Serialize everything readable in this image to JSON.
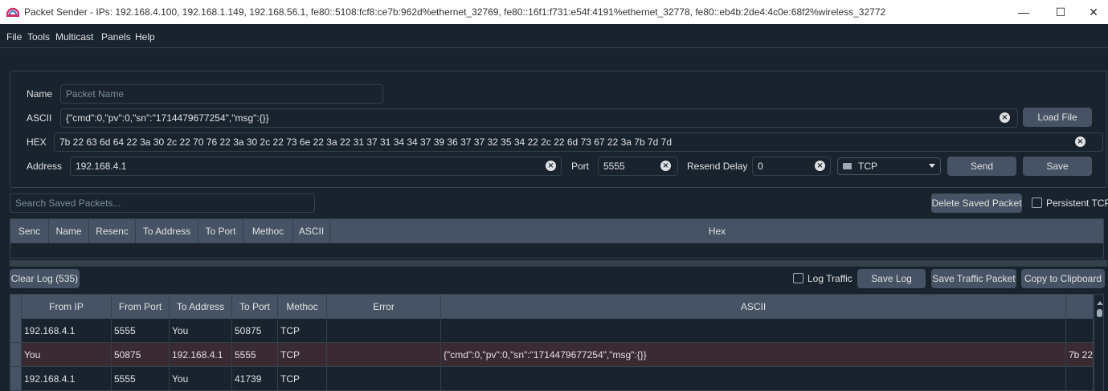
{
  "window": {
    "title": "Packet Sender - IPs: 192.168.4.100, 192.168.1.149, 192.168.56.1, fe80::5108:fcf8:ce7b:962d%ethernet_32769, fe80::16f1:f731:e54f:4191%ethernet_32778, fe80::eb4b:2de4:4c0e:68f2%wireless_32772",
    "minimize": "—",
    "maximize": "☐",
    "close": "✕"
  },
  "menu": [
    "File",
    "Tools",
    "Multicast",
    "Panels",
    "Help"
  ],
  "form": {
    "name_label": "Name",
    "name_placeholder": "Packet Name",
    "ascii_label": "ASCII",
    "ascii_value": "{\"cmd\":0,\"pv\":0,\"sn\":\"1714479677254\",\"msg\":{}}",
    "load_file": "Load File",
    "hex_label": "HEX",
    "hex_value": "7b 22 63 6d 64 22 3a 30 2c 22 70 76 22 3a 30 2c 22 73 6e 22 3a 22 31 37 31 34 34 37 39 36 37 37 32 35 34 22 2c 22 6d 73 67 22 3a 7b 7d 7d",
    "address_label": "Address",
    "address_value": "192.168.4.1",
    "port_label": "Port",
    "port_value": "5555",
    "resend_label": "Resend Delay",
    "resend_value": "0",
    "protocol": "TCP",
    "send": "Send",
    "save": "Save"
  },
  "saved": {
    "search_placeholder": "Search Saved Packets...",
    "delete_button": "Delete Saved Packet",
    "persistent_label": "Persistent TCP",
    "columns": [
      "Senc",
      "Name",
      "Resenc",
      "To Address",
      "To Port",
      "Methoc",
      "ASCII",
      "Hex"
    ]
  },
  "log": {
    "clear_button": "Clear Log (535)",
    "log_traffic_label": "Log Traffic",
    "save_log": "Save Log",
    "save_traffic_packet": "Save Traffic Packet",
    "copy_clipboard": "Copy to Clipboard",
    "columns": [
      "From IP",
      "From Port",
      "To Address",
      "To Port",
      "Methoc",
      "Error",
      "ASCII"
    ],
    "rows": [
      {
        "from_ip": "192.168.4.1",
        "from_port": "5555",
        "to_address": "You",
        "to_port": "50875",
        "method": "TCP",
        "error": "",
        "ascii": "",
        "hex": ""
      },
      {
        "from_ip": "You",
        "from_port": "50875",
        "to_address": "192.168.4.1",
        "to_port": "5555",
        "method": "TCP",
        "error": "",
        "ascii": "{\"cmd\":0,\"pv\":0,\"sn\":\"1714479677254\",\"msg\":{}}",
        "hex": "7b 22"
      },
      {
        "from_ip": "192.168.4.1",
        "from_port": "5555",
        "to_address": "You",
        "to_port": "41739",
        "method": "TCP",
        "error": "",
        "ascii": "",
        "hex": ""
      }
    ]
  }
}
